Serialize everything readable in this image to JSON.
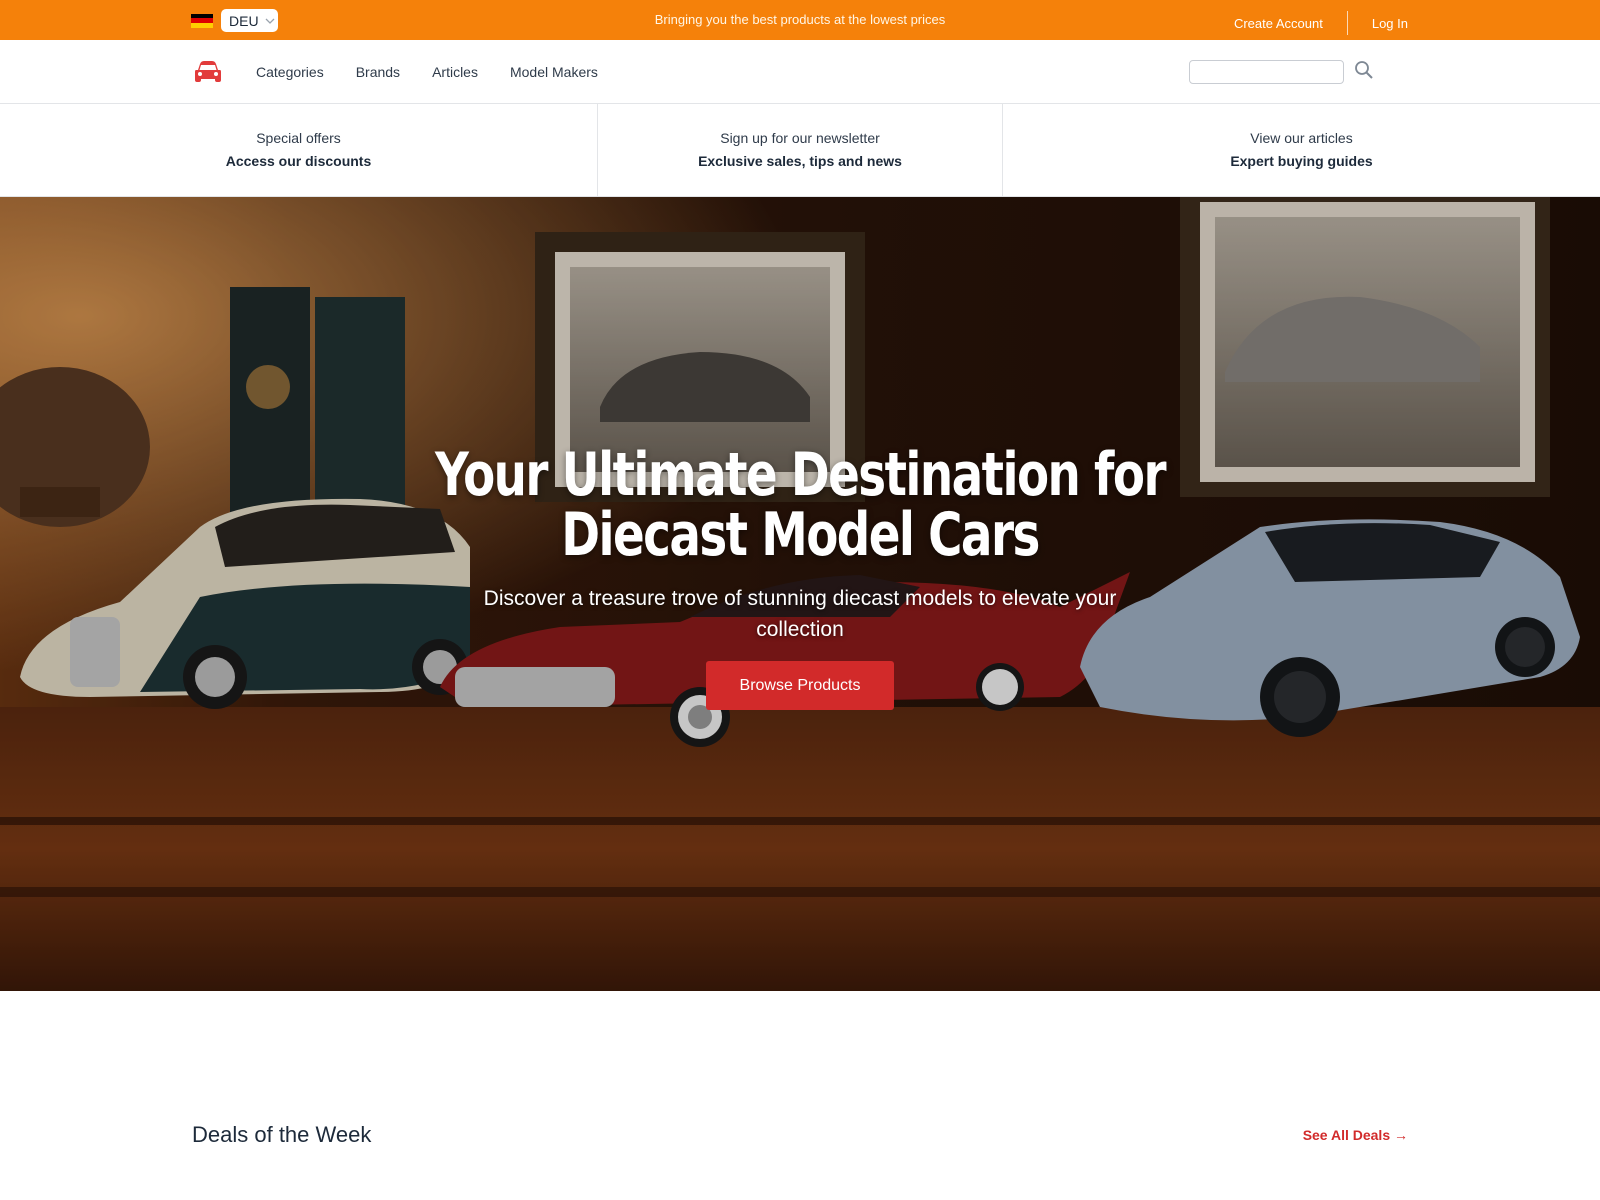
{
  "topbar": {
    "locale": {
      "flag": "germany-flag",
      "code": "DEU"
    },
    "tagline": "Bringing you the best products at the lowest prices",
    "create_account": "Create Account",
    "login": "Log In"
  },
  "nav": {
    "logo": "car-icon",
    "links": [
      "Categories",
      "Brands",
      "Articles",
      "Model Makers"
    ],
    "search": {
      "placeholder": "",
      "value": "",
      "icon": "search-icon"
    }
  },
  "promos": [
    {
      "sub": "Special offers",
      "main": "Access our discounts"
    },
    {
      "sub": "Sign up for our newsletter",
      "main": "Exclusive sales, tips and news"
    },
    {
      "sub": "View our articles",
      "main": "Expert buying guides"
    }
  ],
  "hero": {
    "title_line1": "Your Ultimate Destination for",
    "title_line2": "Diecast Model Cars",
    "subtitle": "Discover a treasure trove of stunning diecast models to elevate your collection",
    "button": "Browse Products"
  },
  "deals": {
    "title": "Deals of the Week",
    "link": "See All Deals →"
  },
  "colors": {
    "accent_orange": "#f5810a",
    "accent_red": "#d22a2a",
    "text_dark": "#1d2a3a"
  }
}
